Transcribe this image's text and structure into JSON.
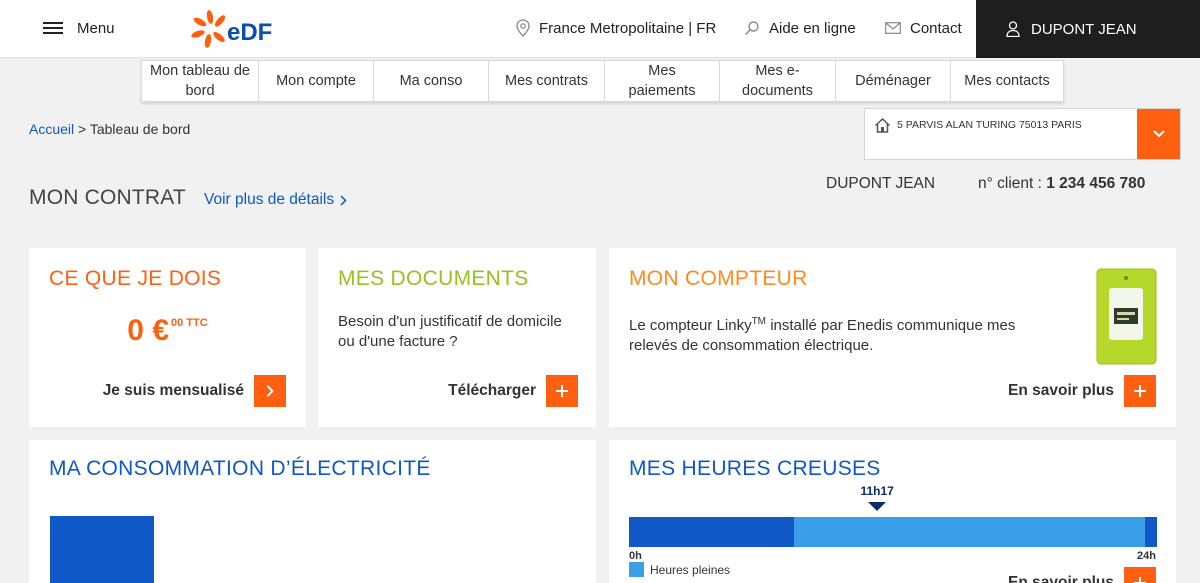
{
  "header": {
    "menu_label": "Menu",
    "logo_text": "eDF",
    "region": "France Metropolitaine | FR",
    "help": "Aide en ligne",
    "contact": "Contact",
    "user": "DUPONT JEAN"
  },
  "nav": {
    "items": [
      {
        "label": "Mon tableau de bord"
      },
      {
        "label": "Mon compte"
      },
      {
        "label": "Ma conso"
      },
      {
        "label": "Mes contrats"
      },
      {
        "label": "Mes paiements"
      },
      {
        "label": "Mes e-documents"
      },
      {
        "label": "Déménager"
      },
      {
        "label": "Mes contacts"
      }
    ]
  },
  "breadcrumb": {
    "home": "Accueil",
    "separator": ">",
    "current": "Tableau de bord"
  },
  "address": {
    "text": "5 PARVIS ALAN TURING 75013 PARIS"
  },
  "contract": {
    "title": "MON CONTRAT",
    "details_link": "Voir plus de détails",
    "client_name": "DUPONT JEAN",
    "client_number_label": "n° client :",
    "client_number": "1 234 456 780"
  },
  "cards": {
    "dois": {
      "title": "CE QUE JE DOIS",
      "amount": "0 €",
      "amount_sup": "00 TTC",
      "action": "Je suis mensualisé"
    },
    "documents": {
      "title": "MES DOCUMENTS",
      "text_line1": "Besoin d'un justificatif de domicile",
      "text_line2": "ou d'une facture ?",
      "action": "Télécharger"
    },
    "compteur": {
      "title": "MON COMPTEUR",
      "text_line1_a": "Le compteur Linky",
      "text_line1_sup": "TM",
      "text_line1_b": " installé par Enedis communique mes",
      "text_line2": "relevés de consommation électrique.",
      "action": "En savoir plus"
    },
    "consommation": {
      "title": "MA CONSOMMATION D’ÉLECTRICITÉ"
    },
    "heures_creuses": {
      "title": "MES HEURES CREUSES",
      "current_time": "11h17",
      "start_label": "0h",
      "end_label": "24h",
      "legend_label": "Heures pleines",
      "action": "En savoir plus",
      "current_fraction": 0.47
    }
  },
  "colors": {
    "orange": "#ff5f10",
    "blue": "#1057c8",
    "light_blue": "#3b9ee8",
    "green": "#96c11f",
    "dark": "#1e1e1e"
  }
}
